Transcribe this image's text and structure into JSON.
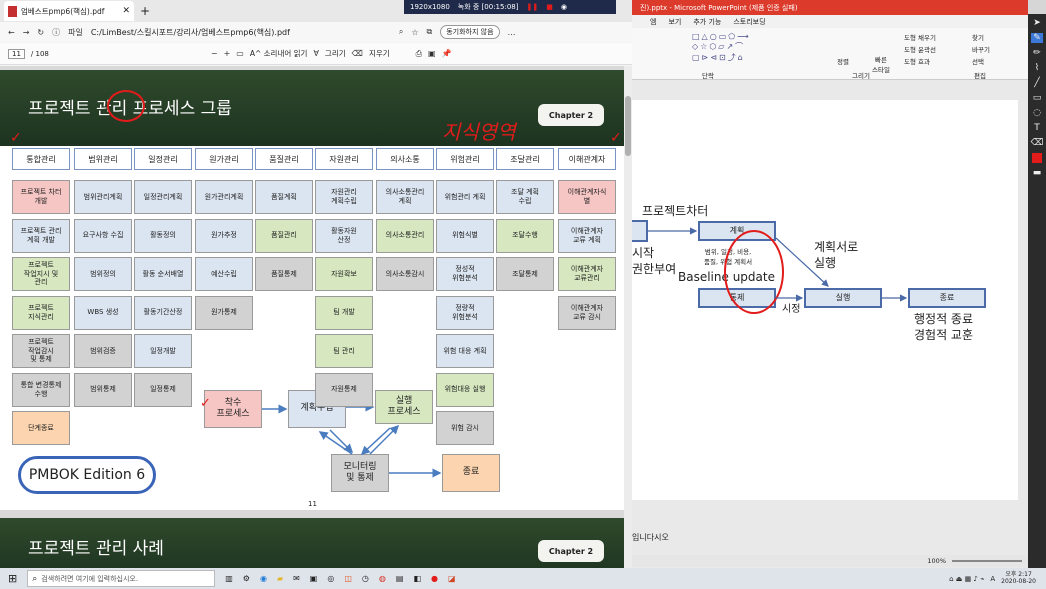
{
  "edge": {
    "tab_title": "엄베스트pmp6(핵심).pdf",
    "address": "C:/LimBest/스킬시포트/강리사/엄베스트pmp6(핵심).pdf",
    "file_label": "파일",
    "sync_label": "동기화하지 않음"
  },
  "pdf": {
    "page_current": "11",
    "page_total": "/ 108",
    "read_aloud": "A^ 소리내어 읽기",
    "draw": "그리기",
    "erase": "지우기",
    "slide1": {
      "title": "프로젝트 관리 프로세스 그룹",
      "chapter": "Chapter 2",
      "page_num": "11",
      "pmbok": "PMBOK Edition 6",
      "handwriting": "지식영역"
    },
    "slide2": {
      "title": "프로젝트 관리 사례",
      "chapter": "Chapter 2"
    }
  },
  "grid": {
    "headers": [
      "통합관리",
      "범위관리",
      "일정관리",
      "원가관리",
      "품질관리",
      "자원관리",
      "의사소통",
      "위험관리",
      "조달관리",
      "이해관계자"
    ],
    "columns": [
      [
        {
          "t": "프로젝트 차터\n개발",
          "c": "pink"
        },
        {
          "t": "프로젝트 관리\n계획 개발",
          "c": "blue"
        },
        {
          "t": "프로젝트\n작업지시 및\n관리",
          "c": "green"
        },
        {
          "t": "프로젝트\n지식관리",
          "c": "green"
        },
        {
          "t": "프로젝트\n작업감시\n및 통제",
          "c": "gray"
        },
        {
          "t": "통합 변경통제\n수행",
          "c": "gray"
        },
        {
          "t": "단계종료",
          "c": "orange"
        }
      ],
      [
        {
          "t": "범위관리계획",
          "c": "blue"
        },
        {
          "t": "요구사항 수집",
          "c": "blue"
        },
        {
          "t": "범위정의",
          "c": "blue"
        },
        {
          "t": "WBS 생성",
          "c": "blue"
        },
        {
          "t": "범위검증",
          "c": "gray"
        },
        {
          "t": "범위통제",
          "c": "gray"
        }
      ],
      [
        {
          "t": "일정관리계획",
          "c": "blue"
        },
        {
          "t": "활동정의",
          "c": "blue"
        },
        {
          "t": "활동 순서배열",
          "c": "blue"
        },
        {
          "t": "활동기간산정",
          "c": "blue"
        },
        {
          "t": "일정개발",
          "c": "blue"
        },
        {
          "t": "일정통제",
          "c": "gray"
        }
      ],
      [
        {
          "t": "원가관리계획",
          "c": "blue"
        },
        {
          "t": "원가추정",
          "c": "blue"
        },
        {
          "t": "예산수립",
          "c": "blue"
        },
        {
          "t": "원가통제",
          "c": "gray"
        }
      ],
      [
        {
          "t": "품질계획",
          "c": "blue"
        },
        {
          "t": "품질관리",
          "c": "green"
        },
        {
          "t": "품질통제",
          "c": "gray"
        }
      ],
      [
        {
          "t": "자원관리\n계획수립",
          "c": "blue"
        },
        {
          "t": "활동자원\n산정",
          "c": "blue"
        },
        {
          "t": "자원확보",
          "c": "green"
        },
        {
          "t": "팀 개발",
          "c": "green"
        },
        {
          "t": "팀 관리",
          "c": "green"
        },
        {
          "t": "자원통제",
          "c": "gray"
        }
      ],
      [
        {
          "t": "의사소통관리\n계획",
          "c": "blue"
        },
        {
          "t": "의사소통관리",
          "c": "green"
        },
        {
          "t": "의사소통감시",
          "c": "gray"
        }
      ],
      [
        {
          "t": "위험관리 계획",
          "c": "blue"
        },
        {
          "t": "위험식별",
          "c": "blue"
        },
        {
          "t": "정성적\n위험분석",
          "c": "blue"
        },
        {
          "t": "정량적\n위험분석",
          "c": "blue"
        },
        {
          "t": "위험 대응 계획",
          "c": "blue"
        },
        {
          "t": "위험대응 실행",
          "c": "green"
        },
        {
          "t": "위험 감시",
          "c": "gray"
        }
      ],
      [
        {
          "t": "조달 계획\n수립",
          "c": "blue"
        },
        {
          "t": "조달수행",
          "c": "green"
        },
        {
          "t": "조달통제",
          "c": "gray"
        }
      ],
      [
        {
          "t": "이해관계자식\n별",
          "c": "pink"
        },
        {
          "t": "이해관계자\n교류 계획",
          "c": "blue"
        },
        {
          "t": "이해관계자\n교류관리",
          "c": "green"
        },
        {
          "t": "이해관계자\n교류 감시",
          "c": "gray"
        }
      ]
    ]
  },
  "flow": {
    "start": "착수\n프로세스",
    "plan": "계획수립",
    "exec": "실행\n프로세스",
    "monitor": "모니터링\n및 통제",
    "close": "종료"
  },
  "ppt": {
    "title": "진).pptx  -  Microsoft PowerPoint (제품 인증 실패)",
    "ribbon_tabs": [
      "엠",
      "보기",
      "추가 기능",
      "스토리보딩"
    ],
    "groups": [
      "단락",
      "그리기",
      "편집"
    ],
    "ribbon_items": {
      "find": "찾기",
      "replace": "바꾸기",
      "select": "선택",
      "arrange": "정렬",
      "quick": "빠른\n스타일",
      "fill": "도형 채우기",
      "outline": "도형 윤곽선",
      "effect": "도형 효과"
    },
    "slide": {
      "charter": "프로젝트차터",
      "start_partial": "시작\n권한부여",
      "plan": "계획",
      "plan_sub": "범위, 일정, 비용,\n품질, 위험 계획서",
      "contract": "계획서로\n실행",
      "baseline": "Baseline update",
      "control": "통제",
      "exec": "실행",
      "close": "종료",
      "close_sub": "행정적 종료\n경험적 교훈",
      "side": "시정"
    },
    "notes": "입니다시오",
    "zoom": "100%"
  },
  "recorder": {
    "res": "1920x1080",
    "rec": "녹화 중 [00:15:08]"
  },
  "taskbar": {
    "search": "검색하려면 여기에 입력하십시오.",
    "time": "오후 2:17",
    "date": "2020-08-20",
    "lang": "A"
  }
}
